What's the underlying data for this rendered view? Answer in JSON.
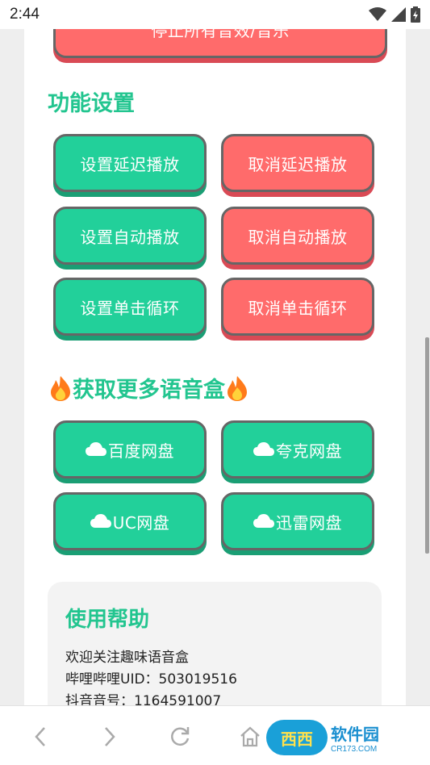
{
  "status_bar": {
    "time": "2:44"
  },
  "top_button": {
    "label": "停止所有音效/音乐"
  },
  "function_settings": {
    "title": "功能设置",
    "buttons": [
      {
        "label": "设置延迟播放"
      },
      {
        "label": "取消延迟播放"
      },
      {
        "label": "设置自动播放"
      },
      {
        "label": "取消自动播放"
      },
      {
        "label": "设置单击循环"
      },
      {
        "label": "取消单击循环"
      }
    ]
  },
  "more_boxes": {
    "title": "获取更多语音盒",
    "buttons": [
      {
        "label": "百度网盘"
      },
      {
        "label": "夸克网盘"
      },
      {
        "label": "UC网盘"
      },
      {
        "label": "迅雷网盘"
      }
    ]
  },
  "help": {
    "title": "使用帮助",
    "lines": [
      "欢迎关注趣味语音盒",
      "哔哩哔哩UID：503019516",
      "抖音音号：1164591007"
    ]
  },
  "watermark": {
    "logo": "西西",
    "main": "软件园",
    "sub": "CR173.COM"
  },
  "colors": {
    "accent_green": "#22d09a",
    "accent_red": "#ff6b6b",
    "heading_green": "#22c58f"
  },
  "icons": [
    "wifi-icon",
    "signal-icon",
    "battery-icon",
    "fire-icon",
    "cloud-icon",
    "back-icon",
    "forward-icon",
    "reload-icon",
    "home-icon"
  ]
}
